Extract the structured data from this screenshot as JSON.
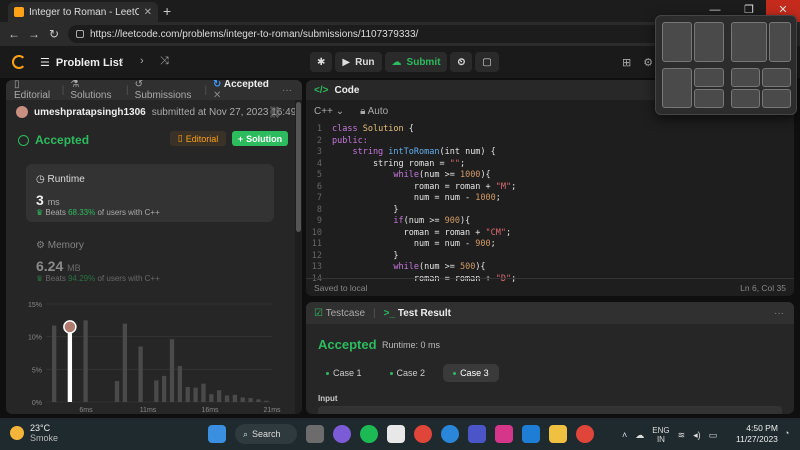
{
  "browser": {
    "tab_title": "Integer to Roman - LeetCode",
    "url": "https://leetcode.com/problems/integer-to-roman/submissions/1107379333/"
  },
  "nav": {
    "problem_list": "Problem List",
    "run": "Run",
    "submit": "Submit"
  },
  "left_tabs": [
    {
      "label": "Editorial"
    },
    {
      "label": "Solutions"
    },
    {
      "label": "Submissions"
    },
    {
      "label": "Accepted"
    }
  ],
  "submission": {
    "user": "umeshpratapsingh1306",
    "submitted_text": "submitted at Nov 27, 2023 16:49",
    "status": "Accepted",
    "editorial_btn": "Editorial",
    "solution_btn": "Solution"
  },
  "runtime": {
    "label": "Runtime",
    "value": "3",
    "unit": "ms",
    "beats_prefix": "Beats",
    "beats_pct": "68.33%",
    "beats_suffix": "of users with C++"
  },
  "memory": {
    "label": "Memory",
    "value": "6.24",
    "unit": "MB",
    "beats_prefix": "Beats",
    "beats_pct": "94.29%",
    "beats_suffix": "of users with C++"
  },
  "chart_data": {
    "type": "bar",
    "yticks": [
      "15%",
      "10%",
      "5%",
      "0%"
    ],
    "xticks": [
      "6ms",
      "11ms",
      "16ms",
      "21ms"
    ],
    "ylim": [
      0,
      15
    ],
    "values": [
      11.7,
      0,
      0,
      0,
      12.5,
      0,
      0,
      0,
      3.2,
      12,
      0,
      8.5,
      0,
      3.3,
      4,
      9.6,
      5.5,
      2.3,
      2.2,
      2.8,
      1.2,
      1.8,
      1,
      1.1,
      0.7,
      0.6,
      0.4,
      0.2
    ],
    "highlight_index": 2,
    "highlight_value": 11.5,
    "highlight_color": "#ffffff",
    "bar_color": "#4a4a4a"
  },
  "code": {
    "title": "Code",
    "language": "C++",
    "auto": "Auto",
    "lines": [
      [
        {
          "t": "class ",
          "c": "kw"
        },
        {
          "t": "Solution",
          "c": "ty"
        },
        {
          "t": " {",
          "c": ""
        }
      ],
      [
        {
          "t": "public:",
          "c": "kw"
        }
      ],
      [
        {
          "t": "    string ",
          "c": "kw"
        },
        {
          "t": "intToRoman",
          "c": "fn"
        },
        {
          "t": "(int num) {",
          "c": ""
        }
      ],
      [
        {
          "t": "        string roman = ",
          "c": ""
        },
        {
          "t": "\"\"",
          "c": "str"
        },
        {
          "t": ";",
          "c": ""
        }
      ],
      [
        {
          "t": "            while",
          "c": "kw"
        },
        {
          "t": "(num >= ",
          "c": ""
        },
        {
          "t": "1000",
          "c": "num"
        },
        {
          "t": "){",
          "c": ""
        }
      ],
      [
        {
          "t": "                roman = roman + ",
          "c": ""
        },
        {
          "t": "\"M\"",
          "c": "str"
        },
        {
          "t": ";",
          "c": ""
        }
      ],
      [
        {
          "t": "                num = num - ",
          "c": ""
        },
        {
          "t": "1000",
          "c": "num"
        },
        {
          "t": ";",
          "c": ""
        }
      ],
      [
        {
          "t": "            }",
          "c": ""
        }
      ],
      [
        {
          "t": "            if",
          "c": "kw"
        },
        {
          "t": "(num >= ",
          "c": ""
        },
        {
          "t": "900",
          "c": "num"
        },
        {
          "t": "){",
          "c": ""
        }
      ],
      [
        {
          "t": "              roman = roman + ",
          "c": ""
        },
        {
          "t": "\"CM\"",
          "c": "str"
        },
        {
          "t": ";",
          "c": ""
        }
      ],
      [
        {
          "t": "                num = num - ",
          "c": ""
        },
        {
          "t": "900",
          "c": "num"
        },
        {
          "t": ";",
          "c": ""
        }
      ],
      [
        {
          "t": "            }",
          "c": ""
        }
      ],
      [
        {
          "t": "            while",
          "c": "kw"
        },
        {
          "t": "(num >= ",
          "c": ""
        },
        {
          "t": "500",
          "c": "num"
        },
        {
          "t": "){",
          "c": ""
        }
      ],
      [
        {
          "t": "                roman = roman + ",
          "c": ""
        },
        {
          "t": "\"D\"",
          "c": "str"
        },
        {
          "t": ";",
          "c": ""
        }
      ]
    ],
    "saved": "Saved to local",
    "position": "Ln 6, Col 35"
  },
  "test": {
    "tab_testcase": "Testcase",
    "tab_result": "Test Result",
    "status": "Accepted",
    "runtime": "Runtime: 0 ms",
    "cases": [
      "Case 1",
      "Case 2",
      "Case 3"
    ],
    "active_case": 2,
    "input_label": "Input"
  },
  "taskbar": {
    "temp": "23°C",
    "weather": "Smoke",
    "search": "Search",
    "lang1": "ENG",
    "lang2": "IN",
    "time": "4:50 PM",
    "date": "11/27/2023"
  }
}
